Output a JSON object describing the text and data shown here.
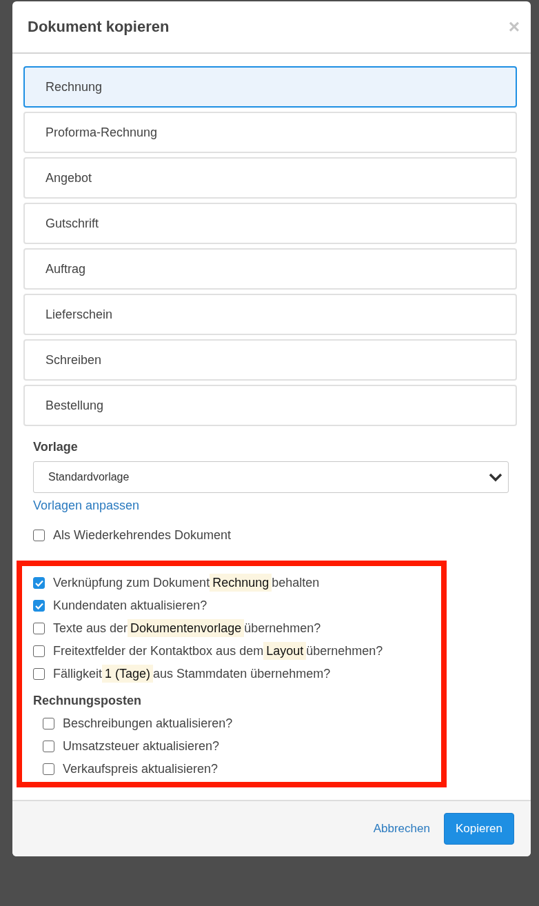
{
  "dialog": {
    "title": "Dokument kopieren",
    "close": "×"
  },
  "document_types": [
    {
      "label": "Rechnung",
      "selected": true
    },
    {
      "label": "Proforma-Rechnung",
      "selected": false
    },
    {
      "label": "Angebot",
      "selected": false
    },
    {
      "label": "Gutschrift",
      "selected": false
    },
    {
      "label": "Auftrag",
      "selected": false
    },
    {
      "label": "Lieferschein",
      "selected": false
    },
    {
      "label": "Schreiben",
      "selected": false
    },
    {
      "label": "Bestellung",
      "selected": false
    }
  ],
  "template": {
    "label": "Vorlage",
    "value": "Standardvorlage",
    "link": "Vorlagen anpassen"
  },
  "recurring": {
    "label": "Als Wiederkehrendes Dokument",
    "checked": false
  },
  "options": [
    {
      "checked": true,
      "parts": [
        {
          "text": "Verknüpfung zum Dokument",
          "kind": "plain"
        },
        {
          "text": "Rechnung",
          "kind": "tag"
        },
        {
          "text": "behalten",
          "kind": "plain"
        }
      ]
    },
    {
      "checked": true,
      "parts": [
        {
          "text": "Kundendaten aktualisieren?",
          "kind": "plain"
        }
      ]
    },
    {
      "checked": false,
      "parts": [
        {
          "text": "Texte aus der",
          "kind": "plain"
        },
        {
          "text": "Dokumentenvorlage",
          "kind": "tag"
        },
        {
          "text": "übernehmen?",
          "kind": "plain"
        }
      ]
    },
    {
      "checked": false,
      "parts": [
        {
          "text": "Freitextfelder der Kontaktbox aus dem",
          "kind": "plain"
        },
        {
          "text": "Layout",
          "kind": "tag"
        },
        {
          "text": "übernehmen?",
          "kind": "plain"
        }
      ]
    },
    {
      "checked": false,
      "parts": [
        {
          "text": "Fälligkeit",
          "kind": "plain"
        },
        {
          "text": "1 (Tage)",
          "kind": "tag"
        },
        {
          "text": "aus Stammdaten übernehmem?",
          "kind": "plain"
        }
      ]
    }
  ],
  "line_items": {
    "heading": "Rechnungsposten",
    "options": [
      {
        "label": "Beschreibungen aktualisieren?",
        "checked": false
      },
      {
        "label": "Umsatzsteuer aktualisieren?",
        "checked": false
      },
      {
        "label": "Verkaufspreis aktualisieren?",
        "checked": false
      }
    ]
  },
  "footer": {
    "cancel": "Abbrechen",
    "confirm": "Kopieren"
  }
}
